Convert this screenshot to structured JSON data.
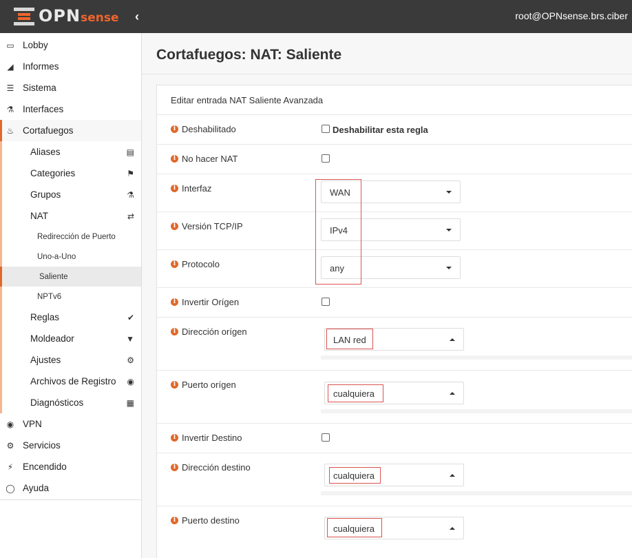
{
  "header": {
    "logo_text": "OPN",
    "logo_text_sense": "sense",
    "user": "root@OPNsense.brs.ciber"
  },
  "sidebar": {
    "items": [
      {
        "label": "Lobby",
        "icon": "laptop-icon"
      },
      {
        "label": "Informes",
        "icon": "area-chart-icon"
      },
      {
        "label": "Sistema",
        "icon": "server-icon"
      },
      {
        "label": "Interfaces",
        "icon": "sitemap-icon"
      },
      {
        "label": "Cortafuegos",
        "icon": "fire-icon"
      }
    ],
    "firewall_sub": [
      {
        "label": "Aliases",
        "icon": "list-alt-icon"
      },
      {
        "label": "Categories",
        "icon": "tags-icon"
      },
      {
        "label": "Grupos",
        "icon": "sitemap-icon"
      },
      {
        "label": "NAT",
        "icon": "exchange-icon"
      }
    ],
    "nat_sub": [
      {
        "label": "Redirección de Puerto"
      },
      {
        "label": "Uno-a-Uno"
      },
      {
        "label": "Saliente"
      },
      {
        "label": "NPTv6"
      }
    ],
    "firewall_sub2": [
      {
        "label": "Reglas",
        "icon": "check-icon"
      },
      {
        "label": "Moldeador",
        "icon": "filter-icon"
      },
      {
        "label": "Ajustes",
        "icon": "cogs-icon"
      },
      {
        "label": "Archivos de Registro",
        "icon": "eye-icon"
      },
      {
        "label": "Diagnósticos",
        "icon": "medkit-icon"
      }
    ],
    "bottom_items": [
      {
        "label": "VPN",
        "icon": "globe-icon"
      },
      {
        "label": "Servicios",
        "icon": "cog-icon"
      },
      {
        "label": "Encendido",
        "icon": "plug-icon"
      },
      {
        "label": "Ayuda",
        "icon": "life-ring-icon"
      }
    ]
  },
  "main": {
    "title": "Cortafuegos: NAT: Saliente",
    "panel_title": "Editar entrada NAT Saliente Avanzada",
    "fields": {
      "disabled": {
        "label": "Deshabilitado",
        "checkbox_label": "Deshabilitar esta regla"
      },
      "nonat": {
        "label": "No hacer NAT"
      },
      "interface": {
        "label": "Interfaz",
        "value": "WAN"
      },
      "ipprotocol": {
        "label": "Versión TCP/IP",
        "value": "IPv4"
      },
      "protocol": {
        "label": "Protocolo",
        "value": "any"
      },
      "source_not": {
        "label": "Invertir Orígen"
      },
      "source": {
        "label": "Dirección orígen",
        "value": "LAN red"
      },
      "source_port": {
        "label": "Puerto orígen",
        "value": "cualquiera"
      },
      "destination_not": {
        "label": "Invertir Destino"
      },
      "destination": {
        "label": "Dirección destino",
        "value": "cualquiera"
      },
      "destination_port": {
        "label": "Puerto destino",
        "value": "cualquiera"
      }
    }
  }
}
